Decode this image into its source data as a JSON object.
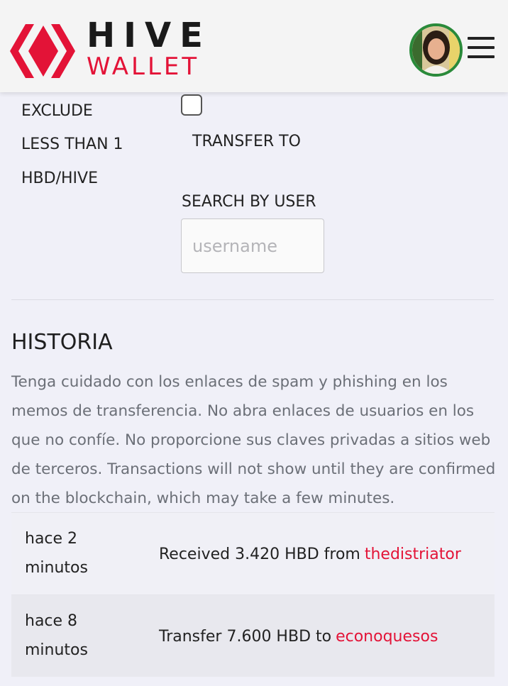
{
  "brand": {
    "word1": "HIVE",
    "word2": "WALLET",
    "accent_color": "#e31337"
  },
  "header": {
    "avatar_icon": "user-avatar",
    "menu_icon": "hamburger-menu-icon"
  },
  "filters": {
    "exclude_lines": [
      "EXCLUDE",
      "LESS THAN 1",
      "HBD/HIVE"
    ],
    "exclude_checked": false,
    "transfer_to_label": "TRANSFER TO",
    "search_label": "SEARCH BY USER",
    "search_placeholder": "username",
    "search_value": ""
  },
  "history": {
    "title": "HISTORIA",
    "notice": "Tenga cuidado con los enlaces de spam y phishing en los memos de transferencia. No abra enlaces de usuarios en los que no confíe. No proporcione sus claves privadas a sitios web de terceros. Transactions will not show until they are confirmed on the blockchain, which may take a few minutes.",
    "transactions": [
      {
        "time_line1": "hace 2",
        "time_line2": "minutos",
        "text": "Received 3.420 HBD from",
        "user": "thedistriator"
      },
      {
        "time_line1": "hace 8",
        "time_line2": "minutos",
        "text": "Transfer 7.600 HBD to",
        "user": "econoquesos"
      }
    ]
  }
}
